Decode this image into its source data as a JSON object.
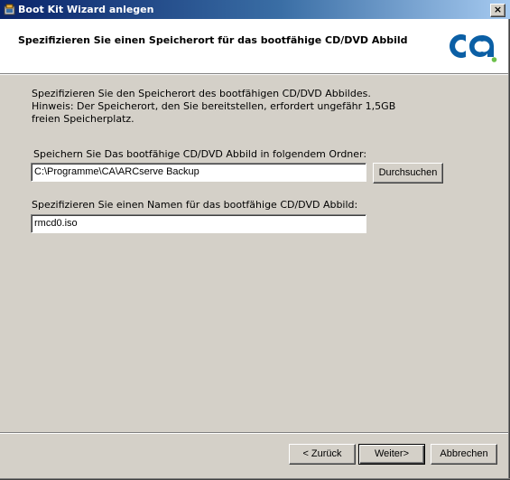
{
  "window": {
    "title": "Boot Kit Wizard anlegen",
    "close_label": "×",
    "icon": "wizard-app-icon"
  },
  "header": {
    "title": "Spezifizieren Sie einen Speicherort für das bootfähige CD/DVD Abbild",
    "logo_text": "ca",
    "logo_color": "#0b5fa5",
    "logo_accent": "#6cc04a"
  },
  "description": {
    "line1": "Spezifizieren Sie den Speicherort des bootfähigen CD/DVD Abbildes.",
    "line2": "Hinweis: Der Speicherort, den Sie bereitstellen, erfordert ungefähr 1,5GB",
    "line3": "freien Speicherplatz."
  },
  "folder": {
    "label": "Speichern Sie Das bootfähige CD/DVD Abbild in folgendem Ordner:",
    "value": "C:\\Programme\\CA\\ARCserve Backup",
    "browse_label": "Durchsuchen"
  },
  "filename": {
    "label": "Spezifizieren Sie einen Namen für das bootfähige CD/DVD Abbild:",
    "value": "rmcd0.iso"
  },
  "footer": {
    "back_label": "< Zurück",
    "next_label": "Weiter>",
    "cancel_label": "Abbrechen"
  }
}
